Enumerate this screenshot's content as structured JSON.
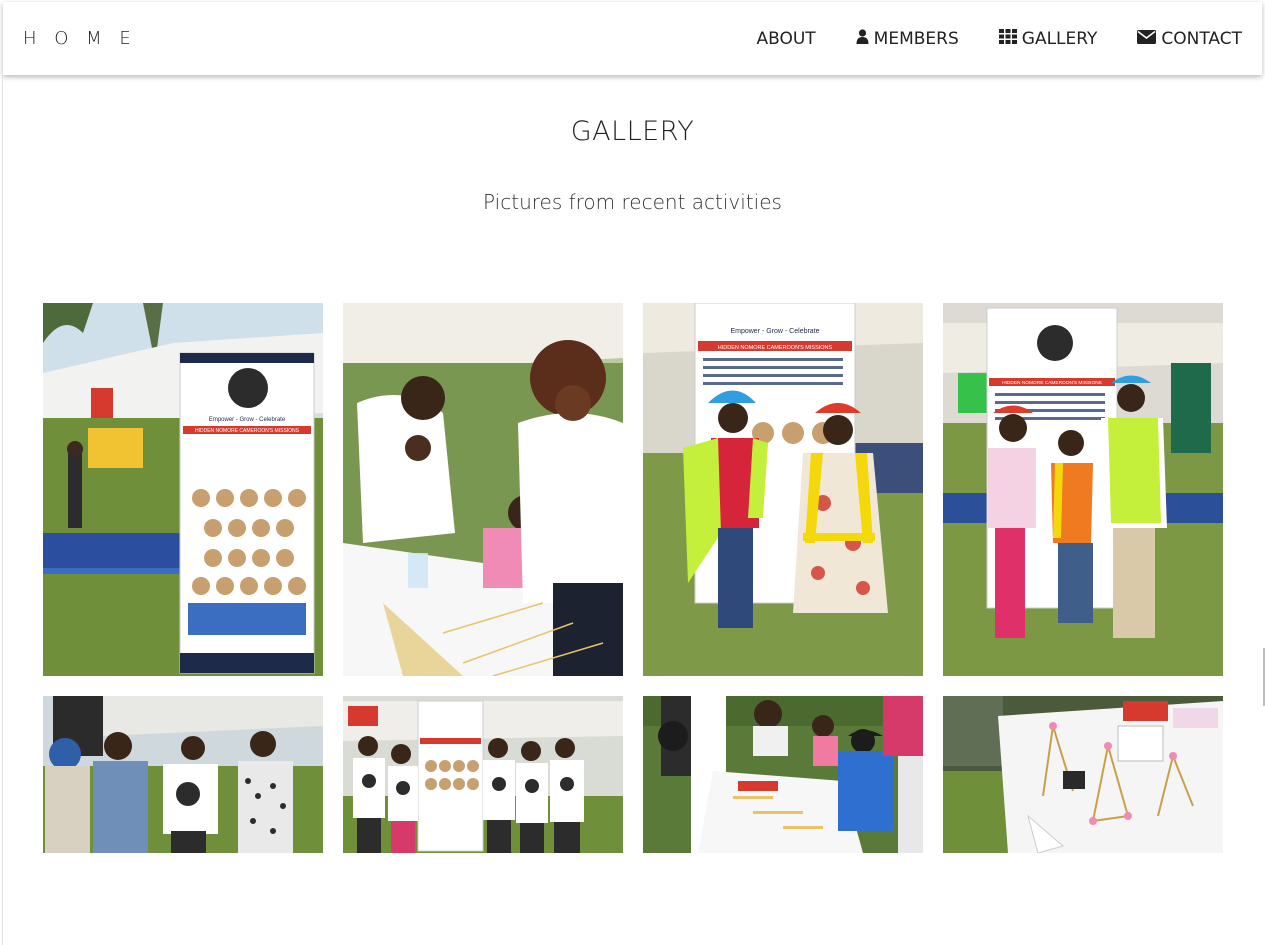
{
  "nav": {
    "brand": "H O M E",
    "links": [
      {
        "label": "ABOUT",
        "icon": "none"
      },
      {
        "label": "MEMBERS",
        "icon": "user-icon"
      },
      {
        "label": "GALLERY",
        "icon": "grid-icon"
      },
      {
        "label": "CONTACT",
        "icon": "envelope-icon"
      }
    ]
  },
  "page": {
    "title": "GALLERY",
    "subtitle": "Pictures from recent activities"
  },
  "gallery": {
    "photos": [
      {
        "subject": "banner-display-outdoor",
        "banner_heading": "HIDDEN NOMORE CAMEROON'S MISSIONS",
        "banner_tagline": "Empower - Grow - Celebrate"
      },
      {
        "subject": "volunteers-helping-child-build"
      },
      {
        "subject": "children-in-hardhats-and-vests",
        "banner_heading": "HIDDEN NOMORE CAMEROON'S MISSIONS",
        "banner_tagline": "Empower - Grow - Celebrate"
      },
      {
        "subject": "three-children-in-safety-gear",
        "banner_heading": "HIDDEN NOMORE CAMEROON'S MISSIONS"
      },
      {
        "subject": "group-conversation-outdoors"
      },
      {
        "subject": "team-in-white-tshirts-by-banner"
      },
      {
        "subject": "children-at-craft-table"
      },
      {
        "subject": "toothpick-structures-on-table"
      }
    ]
  },
  "colors": {
    "accent_red": "#d63a2f",
    "grass": "#6f8f3a",
    "tent_white": "#f2f2f0",
    "sky": "#cfe0ea",
    "navy": "#1e2a4a",
    "hardhat_blue": "#2f9fe0",
    "hardhat_red": "#e03a2a",
    "vest_yellow": "#d9ee2a"
  }
}
